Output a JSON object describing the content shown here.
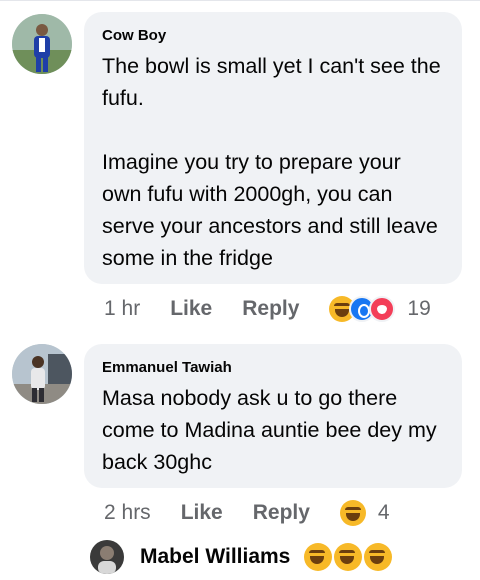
{
  "comments": [
    {
      "author": "Cow Boy",
      "text_lines": [
        "The bowl is small yet I can't see the fufu.",
        "Imagine you try to prepare your own fufu with 2000gh, you can serve your ancestors and still leave some in the fridge"
      ],
      "time": "1 hr",
      "like_label": "Like",
      "reply_label": "Reply",
      "reactions": [
        "haha",
        "wow",
        "love"
      ],
      "reaction_count": "19"
    },
    {
      "author": "Emmanuel Tawiah",
      "text_lines": [
        "Masa nobody ask u to go there come to Madina auntie bee dey my back 30ghc"
      ],
      "time": "2 hrs",
      "like_label": "Like",
      "reply_label": "Reply",
      "reactions": [
        "haha"
      ],
      "reaction_count": "4"
    }
  ],
  "next_commenter": {
    "name": "Mabel Williams",
    "reactions": [
      "haha",
      "haha",
      "haha"
    ]
  }
}
